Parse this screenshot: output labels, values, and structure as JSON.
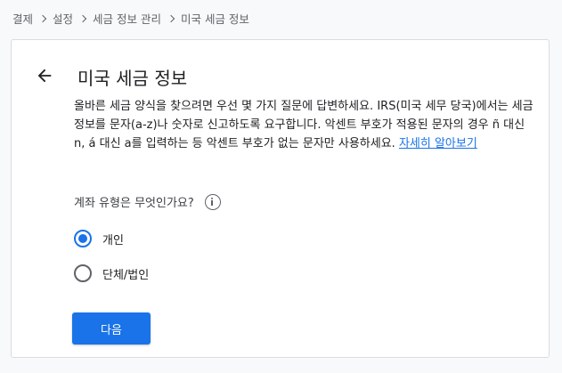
{
  "breadcrumb": {
    "items": [
      "결제",
      "설정",
      "세금 정보 관리",
      "미국 세금 정보"
    ]
  },
  "card": {
    "back_icon": "arrow-back-icon",
    "title": "미국 세금 정보",
    "description_text": "올바른 세금 양식을 찾으려면 우선 몇 가지 질문에 답변하세요. IRS(미국 세무 당국)에서는 세금 정보를 문자(a-z)나 숫자로 신고하도록 요구합니다. 악센트 부호가 적용된 문자의 경우 ñ 대신 n, á 대신 a를 입력하는 등 악센트 부호가 없는 문자만 사용하세요.",
    "learn_more_link": "자세히 알아보기",
    "question": "계좌 유형은 무엇인가요?",
    "info_icon": "info-icon",
    "options": [
      {
        "label": "개인",
        "checked": true
      },
      {
        "label": "단체/법인",
        "checked": false
      }
    ],
    "next_button": "다음"
  },
  "colors": {
    "accent": "#1a73e8",
    "background": "#f8f9fa",
    "card": "#ffffff",
    "border": "#dadce0"
  }
}
